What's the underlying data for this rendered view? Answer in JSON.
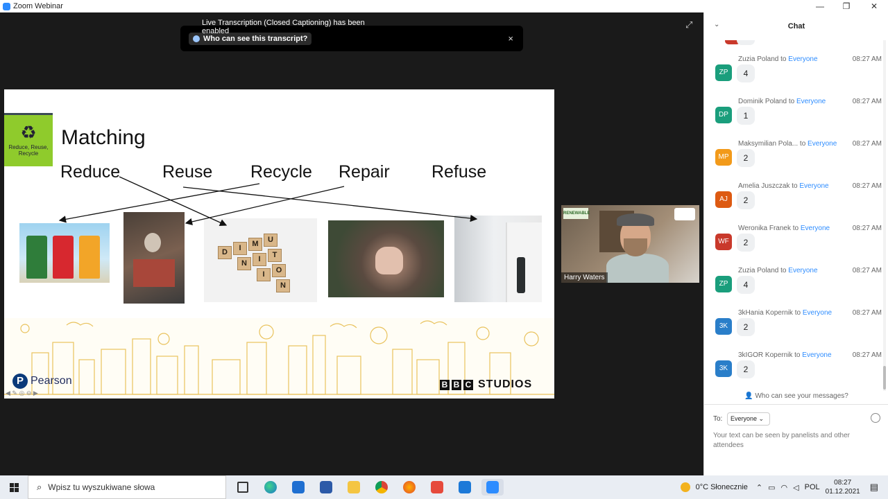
{
  "window": {
    "title": "Zoom Webinar",
    "minimize": "—",
    "maximize": "❐",
    "close": "✕"
  },
  "toast": {
    "message": "Live Transcription (Closed Captioning) has been enabled",
    "button": "Who can see this transcript?",
    "close": "×"
  },
  "slide": {
    "badge_label": "Reduce, Reuse, Recycle",
    "title": "Matching",
    "words": [
      "Reduce",
      "Reuse",
      "Recycle",
      "Repair",
      "Refuse"
    ],
    "tiles": [
      "D",
      "I",
      "M",
      "U",
      "N",
      "I",
      "T",
      "I",
      "O",
      "N"
    ],
    "brand_pearson": "Pearson",
    "brand_bbc": [
      "B",
      "B",
      "C"
    ],
    "brand_studios": "STUDIOS"
  },
  "speaker": {
    "name": "Harry Waters",
    "sign": "RENEWABLE"
  },
  "chat": {
    "title": "Chat",
    "messages": [
      {
        "initials": "ZP",
        "color": "#1a9e7c",
        "sender": "Zuzia Poland",
        "to_word": "to",
        "recipient": "Everyone",
        "time": "08:27 AM",
        "text": "4"
      },
      {
        "initials": "DP",
        "color": "#1a9e7c",
        "sender": "Dominik Poland",
        "to_word": "to",
        "recipient": "Everyone",
        "time": "08:27 AM",
        "text": "1"
      },
      {
        "initials": "MP",
        "color": "#f29a1a",
        "sender": "Maksymilian Pola...",
        "to_word": "to",
        "recipient": "Everyone",
        "time": "08:27 AM",
        "text": "2"
      },
      {
        "initials": "AJ",
        "color": "#dd5a12",
        "sender": "Amelia Juszczak",
        "to_word": "to",
        "recipient": "Everyone",
        "time": "08:27 AM",
        "text": "2"
      },
      {
        "initials": "WF",
        "color": "#c9392b",
        "sender": "Weronika Franek",
        "to_word": "to",
        "recipient": "Everyone",
        "time": "08:27 AM",
        "text": "2"
      },
      {
        "initials": "ZP",
        "color": "#1a9e7c",
        "sender": "Zuzia Poland",
        "to_word": "to",
        "recipient": "Everyone",
        "time": "08:27 AM",
        "text": "4"
      },
      {
        "initials": "3K",
        "color": "#2a7ec9",
        "sender": "3kHania Kopernik",
        "to_word": "to",
        "recipient": "Everyone",
        "time": "08:27 AM",
        "text": "2"
      },
      {
        "initials": "3K",
        "color": "#2a7ec9",
        "sender": "3kIGOR Kopernik",
        "to_word": "to",
        "recipient": "Everyone",
        "time": "08:27 AM",
        "text": "2"
      }
    ],
    "who_can_see": "Who can see your messages?",
    "to_label": "To:",
    "to_value": "Everyone",
    "placeholder": "Your text can be seen by panelists and other attendees"
  },
  "taskbar": {
    "search_placeholder": "Wpisz tu wyszukiwane słowa",
    "weather": "0°C  Słonecznie",
    "lang": "POL",
    "time": "08:27",
    "date": "01.12.2021"
  }
}
